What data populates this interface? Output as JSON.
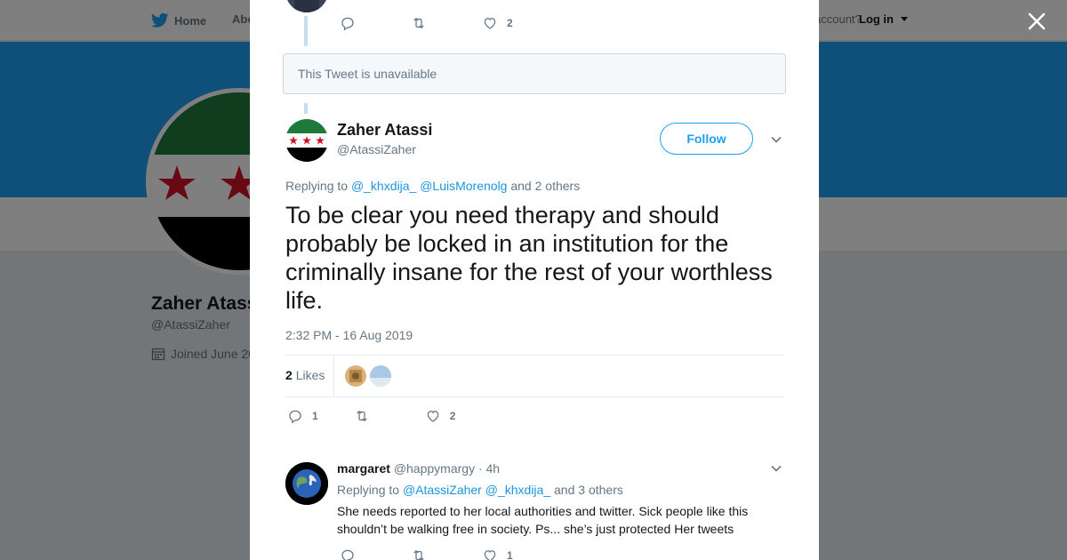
{
  "nav": {
    "home_label": "Home",
    "about_label": "Abo",
    "account_text": "account?",
    "login_label": "Log in"
  },
  "profile": {
    "name": "Zaher Atass",
    "handle": "@AtassiZaher",
    "joined": "Joined June 20"
  },
  "thread": {
    "prev_tweet": {
      "reply_count": "",
      "like_count": "2"
    },
    "unavailable_text": "This Tweet is unavailable"
  },
  "tweet": {
    "author_name": "Zaher Atassi",
    "author_handle": "@AtassiZaher",
    "follow_label": "Follow",
    "replying_prefix": "Replying to",
    "replying_links": [
      "@_khxdija_",
      "@LuisMorenolg"
    ],
    "replying_suffix": "and 2 others",
    "text": "To be clear you need therapy and should probably be locked in an institution for the criminally insane for the rest of your worthless life.",
    "timestamp": "2:32 PM - 16 Aug 2019",
    "likes_number": "2",
    "likes_label": "Likes",
    "reply_count": "1",
    "like_count": "2"
  },
  "reply": {
    "author_name": "margaret",
    "author_handle": "@happymargy",
    "time": "· 4h",
    "replying_prefix": "Replying to",
    "replying_links": [
      "@AtassiZaher",
      "@_khxdija_"
    ],
    "replying_suffix": "and 3 others",
    "text": "She needs reported to her local authorities and twitter. Sick people like this shouldn’t be walking free in society. Ps... she’s just protected Her tweets",
    "like_count": "1"
  },
  "colors": {
    "twitter_blue": "#1da1f2",
    "link_blue": "#1b95e0",
    "muted_text": "#657786",
    "flag_green": "#1f7a3a",
    "flag_red": "#ce1126"
  },
  "icons": [
    "twitter-bird-icon",
    "calendar-icon",
    "close-icon",
    "reply-icon",
    "retweet-icon",
    "like-icon",
    "chevron-down-icon"
  ]
}
